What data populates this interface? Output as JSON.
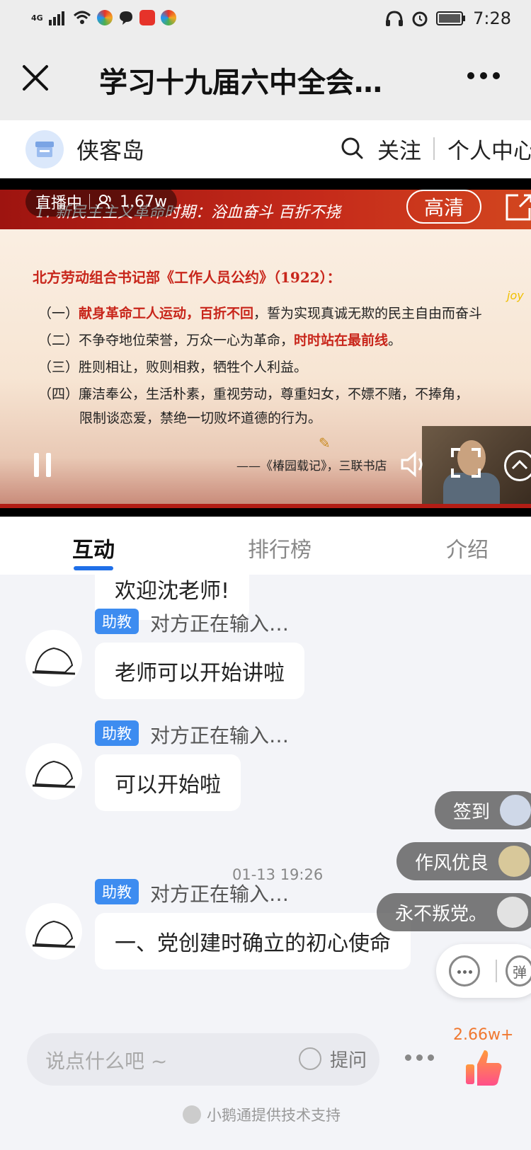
{
  "status_bar": {
    "network": "4G",
    "time": "7:28"
  },
  "nav": {
    "title": "学习十九届六中全会…"
  },
  "shop": {
    "name": "侠客岛",
    "follow_label": "关注",
    "center_label": "个人中心"
  },
  "video": {
    "live_label": "直播中",
    "viewers": "1.67w",
    "quality_label": "高清",
    "banner": "1. 新民主主义革命时期：浴血奋斗 百折不挠",
    "heading": "北方劳动组合书记部《工作人员公约》（1922）：",
    "lines": [
      {
        "prefix": "（一）",
        "red": "献身革命工人运动，百折不回",
        "rest": "，誓为实现真诚无欺的民主自由而奋斗"
      },
      {
        "prefix": "（二）",
        "text": "不争夺地位荣誉，万众一心为革命，",
        "red": "时时站在最前线",
        "end": "。"
      },
      {
        "prefix": "（三）",
        "text": "胜则相让，败则相救，牺牲个人利益。"
      },
      {
        "prefix": "（四）",
        "text": "廉洁奉公，生活朴素，重视劳动，尊重妇女，不嫖不赌，不捧角，"
      },
      {
        "text": "限制谈恋爱，禁绝一切败坏道德的行为。"
      }
    ],
    "source": "——《椿园载记》，三联书店",
    "watermark": "joy"
  },
  "tabs": [
    {
      "label": "互动"
    },
    {
      "label": "排行榜"
    },
    {
      "label": "介绍"
    }
  ],
  "chat": {
    "messages": [
      {
        "text": "欢迎沈老师!"
      },
      {
        "role": "助教",
        "sender": "对方正在输入…",
        "text": "老师可以开始讲啦"
      },
      {
        "role": "助教",
        "sender": "对方正在输入…",
        "text": "可以开始啦"
      },
      {
        "role": "助教",
        "sender": "对方正在输入…",
        "text": "一、党创建时确立的初心使命"
      }
    ],
    "timestamp": "01-13 19:26"
  },
  "danmaku": [
    {
      "text": "签到"
    },
    {
      "text": "作风优良"
    },
    {
      "text": "永不叛党。"
    }
  ],
  "float_action": {
    "danmu_label": "弹"
  },
  "bottom": {
    "input_placeholder": "说点什么吧 ~",
    "ask_label": "提问",
    "like_count": "2.66w+",
    "powered_by": "小鹅通提供技术支持"
  },
  "colors": {
    "accent": "#1f6fe8",
    "badge": "#3d8cf0",
    "highlight_red": "#c8261b",
    "like_orange": "#f07830"
  }
}
